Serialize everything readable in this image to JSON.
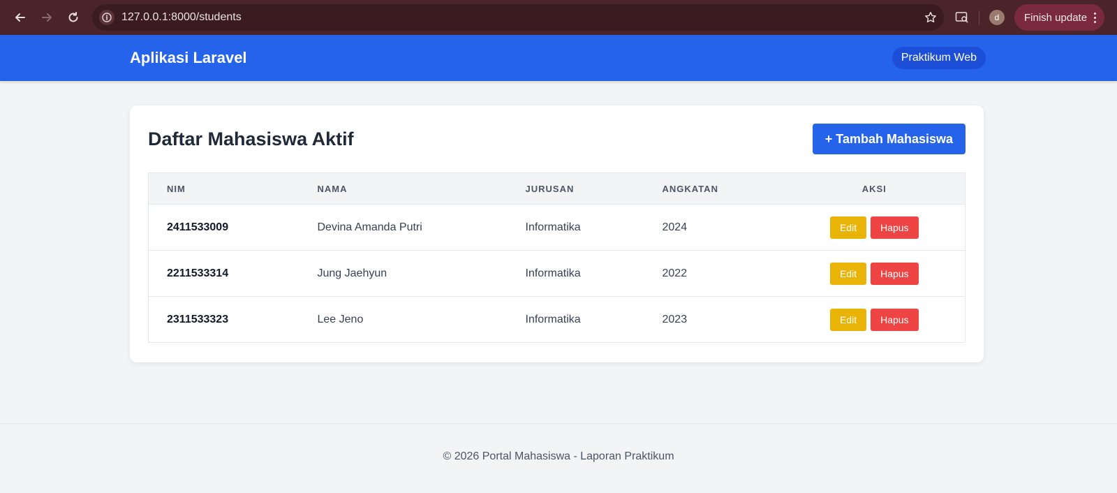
{
  "browser": {
    "url": "127.0.0.1:8000/students",
    "profile_initial": "d",
    "finish_update_label": "Finish update"
  },
  "header": {
    "title": "Aplikasi Laravel",
    "badge": "Praktikum Web"
  },
  "card": {
    "title": "Daftar Mahasiswa Aktif",
    "add_button": "+ Tambah Mahasiswa"
  },
  "table": {
    "columns": [
      "NIM",
      "NAMA",
      "JURUSAN",
      "ANGKATAN",
      "AKSI"
    ],
    "rows": [
      {
        "nim": "2411533009",
        "nama": "Devina Amanda Putri",
        "jurusan": "Informatika",
        "angkatan": "2024",
        "edit": "Edit",
        "hapus": "Hapus"
      },
      {
        "nim": "2211533314",
        "nama": "Jung Jaehyun",
        "jurusan": "Informatika",
        "angkatan": "2022",
        "edit": "Edit",
        "hapus": "Hapus"
      },
      {
        "nim": "2311533323",
        "nama": "Lee Jeno",
        "jurusan": "Informatika",
        "angkatan": "2023",
        "edit": "Edit",
        "hapus": "Hapus"
      }
    ]
  },
  "footer": {
    "text": "© 2026 Portal Mahasiswa - Laporan Praktikum"
  },
  "colors": {
    "primary": "#2563eb",
    "edit": "#eab308",
    "delete": "#ef4444",
    "chrome": "#4a2428"
  }
}
